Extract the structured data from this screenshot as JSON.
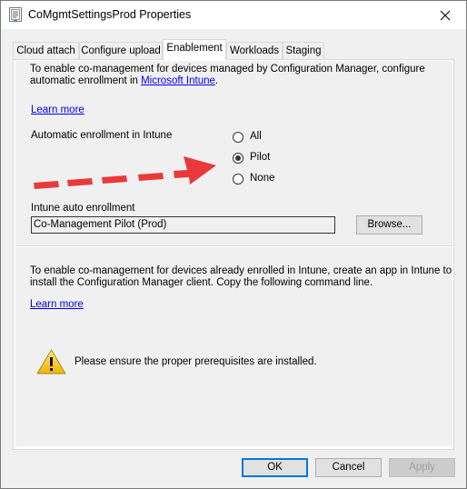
{
  "window": {
    "title": "CoMgmtSettingsProd Properties",
    "title_icon": "properties-sheet-icon",
    "close_icon": "close-icon"
  },
  "tabs": [
    {
      "label": "Cloud attach",
      "active": false
    },
    {
      "label": "Configure upload",
      "active": false
    },
    {
      "label": "Enablement",
      "active": true
    },
    {
      "label": "Workloads",
      "active": false
    },
    {
      "label": "Staging",
      "active": false
    }
  ],
  "section1": {
    "intro_text_1": "To enable co-management for devices managed by Configuration Manager, configure",
    "intro_text_2_prefix": "automatic enrollment in ",
    "intro_link": "Microsoft Intune",
    "intro_text_2_suffix": ".",
    "learn_more": "Learn more",
    "auto_enroll_label": "Automatic enrollment in Intune",
    "radio_options": [
      {
        "label": "All",
        "checked": false
      },
      {
        "label": "Pilot",
        "checked": true
      },
      {
        "label": "None",
        "checked": false
      }
    ],
    "annotation_arrow_color": "#e8393b",
    "collection_label": "Intune auto enrollment",
    "collection_value": "Co-Management Pilot (Prod)",
    "browse_label": "Browse..."
  },
  "section2": {
    "text_1": "To enable co-management for devices already enrolled in Intune, create an app in Intune to",
    "text_2": "install the Configuration Manager client. Copy the following command line.",
    "learn_more": "Learn more",
    "warning_icon": "warning-icon",
    "warning_text": "Please ensure the proper prerequisites are installed."
  },
  "footer": {
    "ok_label": "OK",
    "cancel_label": "Cancel",
    "apply_label": "Apply"
  },
  "colors": {
    "accent": "#0078d7",
    "link": "#0000ee",
    "arrow": "#e8393b",
    "warning": "#f5c400"
  }
}
